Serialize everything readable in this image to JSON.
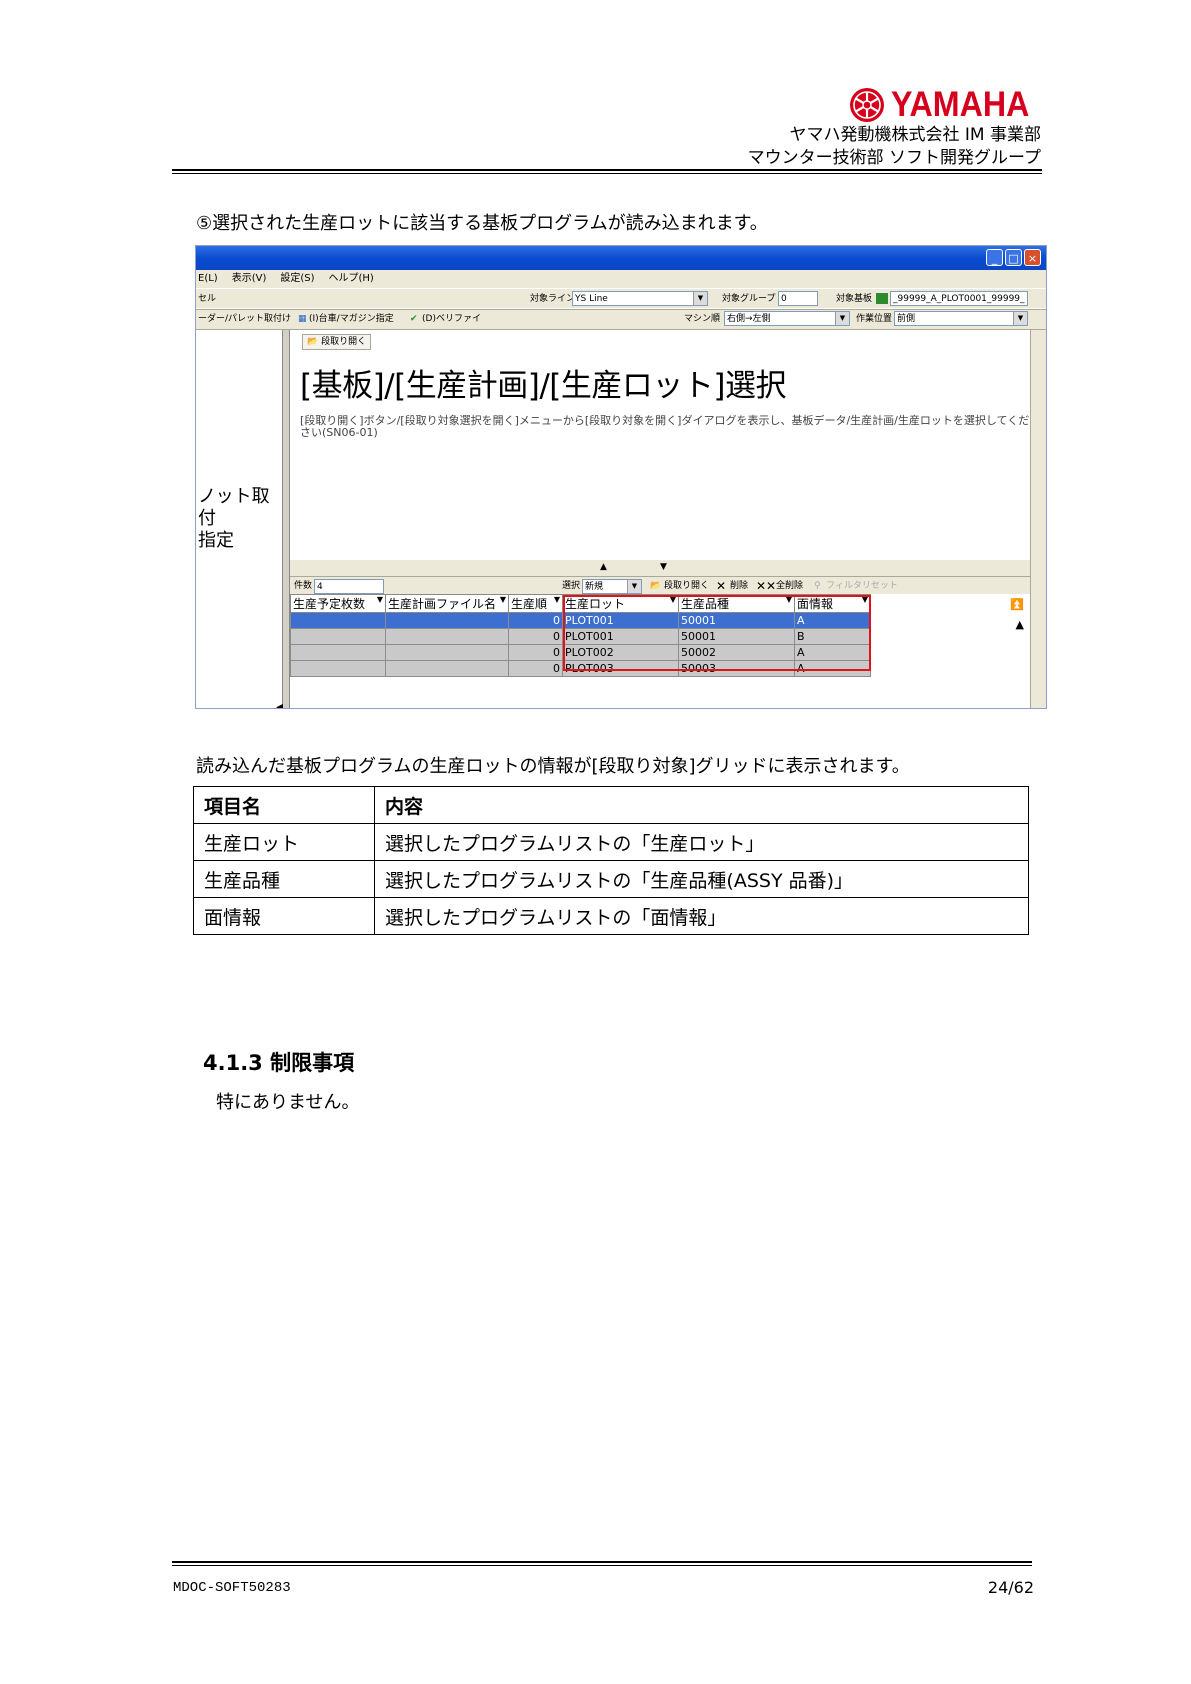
{
  "header": {
    "brand": "YAMAHA",
    "brand_color": "#d6001c",
    "company_line1": "ヤマハ発動機株式会社 IM 事業部",
    "company_line2": "マウンター技術部 ソフト開発グループ"
  },
  "lead_text": "⑤選択された生産ロットに該当する基板プログラムが読み込まれます。",
  "screenshot": {
    "menu": [
      "E(L)",
      "表示(V)",
      "設定(S)",
      "ヘルプ(H)"
    ],
    "toolbar1": {
      "left_label": "セル",
      "line_label": "対象ライン",
      "line_value": "YS Line",
      "group_label": "対象グループ",
      "group_value": "0",
      "board_label": "対象基板",
      "board_value": "_99999_A_PLOT0001_99999_"
    },
    "toolbar2": {
      "btn1": "ーダー/パレット取付け",
      "btn2": "(I)台車/マガジン指定",
      "btn3": "(D)ベリファイ",
      "order_label": "マシン順",
      "order_value": "右側→左側",
      "pos_label": "作業位置",
      "pos_value": "前側"
    },
    "left_label_line1": "ノット取付",
    "left_label_line2": "指定",
    "open_button": "段取り開く",
    "big_title": "[基板]/[生産計画]/[生産ロット]選択",
    "description": "[段取り開く]ボタン/[段取り対象選択を開く]メニューから[段取り対象を開く]ダイアログを表示し、基板データ/生産計画/生産ロットを選択してください(SN06-01)",
    "grid_bar": {
      "count_label": "件数",
      "count_value": "4",
      "select_label": "選択",
      "select_value": "新規",
      "open": "段取り開く",
      "delete": "削除",
      "delete_all": "全削除",
      "filter_reset": "フィルタリセット"
    },
    "grid": {
      "columns": [
        "生産予定枚数",
        "生産計画ファイル名",
        "生産順",
        "生産ロット",
        "生産品種",
        "面情報"
      ],
      "rows": [
        {
          "order": "0",
          "lot": "PLOT001",
          "product": "50001",
          "side": "A"
        },
        {
          "order": "0",
          "lot": "PLOT001",
          "product": "50001",
          "side": "B"
        },
        {
          "order": "0",
          "lot": "PLOT002",
          "product": "50002",
          "side": "A"
        },
        {
          "order": "0",
          "lot": "PLOT003",
          "product": "50003",
          "side": "A"
        }
      ]
    }
  },
  "caption": "読み込んだ基板プログラムの生産ロットの情報が[段取り対象]グリッドに表示されます。",
  "info_table": {
    "headers": [
      "項目名",
      "内容"
    ],
    "rows": [
      [
        "生産ロット",
        "選択したプログラムリストの「生産ロット」"
      ],
      [
        "生産品種",
        "選択したプログラムリストの「生産品種(ASSY 品番)」"
      ],
      [
        "面情報",
        "選択したプログラムリストの「面情報」"
      ]
    ]
  },
  "section": {
    "heading": "4.1.3 制限事項",
    "body": "特にありません。"
  },
  "footer": {
    "doc_id": "MDOC-SOFT50283",
    "page": "24/62"
  }
}
